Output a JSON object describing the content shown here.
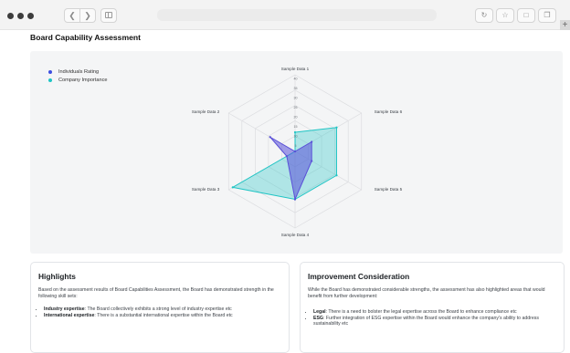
{
  "browser": {
    "nav_back_icon": "chevron-left-icon",
    "nav_forward_icon": "chevron-right-icon",
    "toolbar_icons": [
      "reload-icon",
      "star-icon",
      "share-icon",
      "tabs-icon"
    ]
  },
  "page": {
    "title": "Board Capability Assessment"
  },
  "legend": [
    {
      "label": "Individuals Rating",
      "color": "#3d4fe0"
    },
    {
      "label": "Company Importance",
      "color": "#1ec4c4"
    }
  ],
  "chart_data": {
    "type": "radar",
    "axes": [
      "Sample Data 1",
      "Sample Data 6",
      "Sample Data 5",
      "Sample Data 4",
      "Sample Data 3",
      "Sample Data 2"
    ],
    "ticks": [
      "40",
      "35",
      "30",
      "25",
      "20",
      "15",
      "10",
      "5"
    ],
    "range": [
      0,
      40
    ],
    "series": [
      {
        "name": "Company Importance",
        "color": "#1ec4c4",
        "values": [
          10,
          25,
          25,
          25,
          37.5,
          0
        ]
      },
      {
        "name": "Individuals Rating",
        "color": "#5a50d8",
        "values": [
          0,
          10,
          10,
          25,
          5,
          15
        ]
      }
    ],
    "legend_position": "top-left",
    "grid": true
  },
  "highlights": {
    "title": "Highlights",
    "intro": "Based on the assessment results of Board Capabilities  Assessment, the Board has demonstrated strength in the following skill sets:",
    "items": [
      {
        "term": "Industry expertise",
        "text": ": The Board collectively exhibits a strong level of industry expertise etc"
      },
      {
        "term": "International expertise",
        "text": ": There is a substantial international expertise within the Board etc"
      }
    ]
  },
  "improvement": {
    "title": "Improvement Consideration",
    "intro": "While the Board has demonstrated considerable strengths, the assessment has also highlighted areas that would benefit from further development:",
    "items": [
      {
        "term": "Legal",
        "text": ": There is a need to bolster the legal expertise across the Board to enhance compliance etc"
      },
      {
        "term": "ESG",
        "text": ": Further integration of ESG expertise within the Board would enhance the company's ability to address sustainability etc"
      }
    ]
  }
}
